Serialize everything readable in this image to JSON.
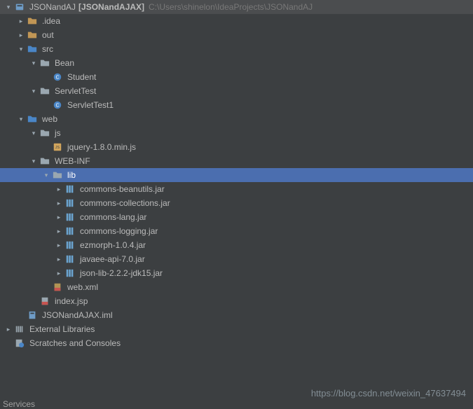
{
  "project": {
    "name": "JSONandAJ",
    "bold_name": "[JSONandAJAX]",
    "path": "C:\\Users\\shinelon\\IdeaProjects\\JSONandAJ"
  },
  "tree": {
    "idea": ".idea",
    "out": "out",
    "src": "src",
    "bean": "Bean",
    "student": "Student",
    "servletTest": "ServletTest",
    "servletTest1": "ServletTest1",
    "web": "web",
    "jsFolder": "js",
    "jquery": "jquery-1.8.0.min.js",
    "webinf": "WEB-INF",
    "lib": "lib",
    "jar1": "commons-beanutils.jar",
    "jar2": "commons-collections.jar",
    "jar3": "commons-lang.jar",
    "jar4": "commons-logging.jar",
    "jar5": "ezmorph-1.0.4.jar",
    "jar6": "javaee-api-7.0.jar",
    "jar7": "json-lib-2.2.2-jdk15.jar",
    "webxml": "web.xml",
    "indexjsp": "index.jsp",
    "iml": "JSONandAJAX.iml",
    "external": "External Libraries",
    "scratches": "Scratches and Consoles"
  },
  "bottom": {
    "services": "Services",
    "watermark": "https://blog.csdn.net/weixin_47637494"
  }
}
